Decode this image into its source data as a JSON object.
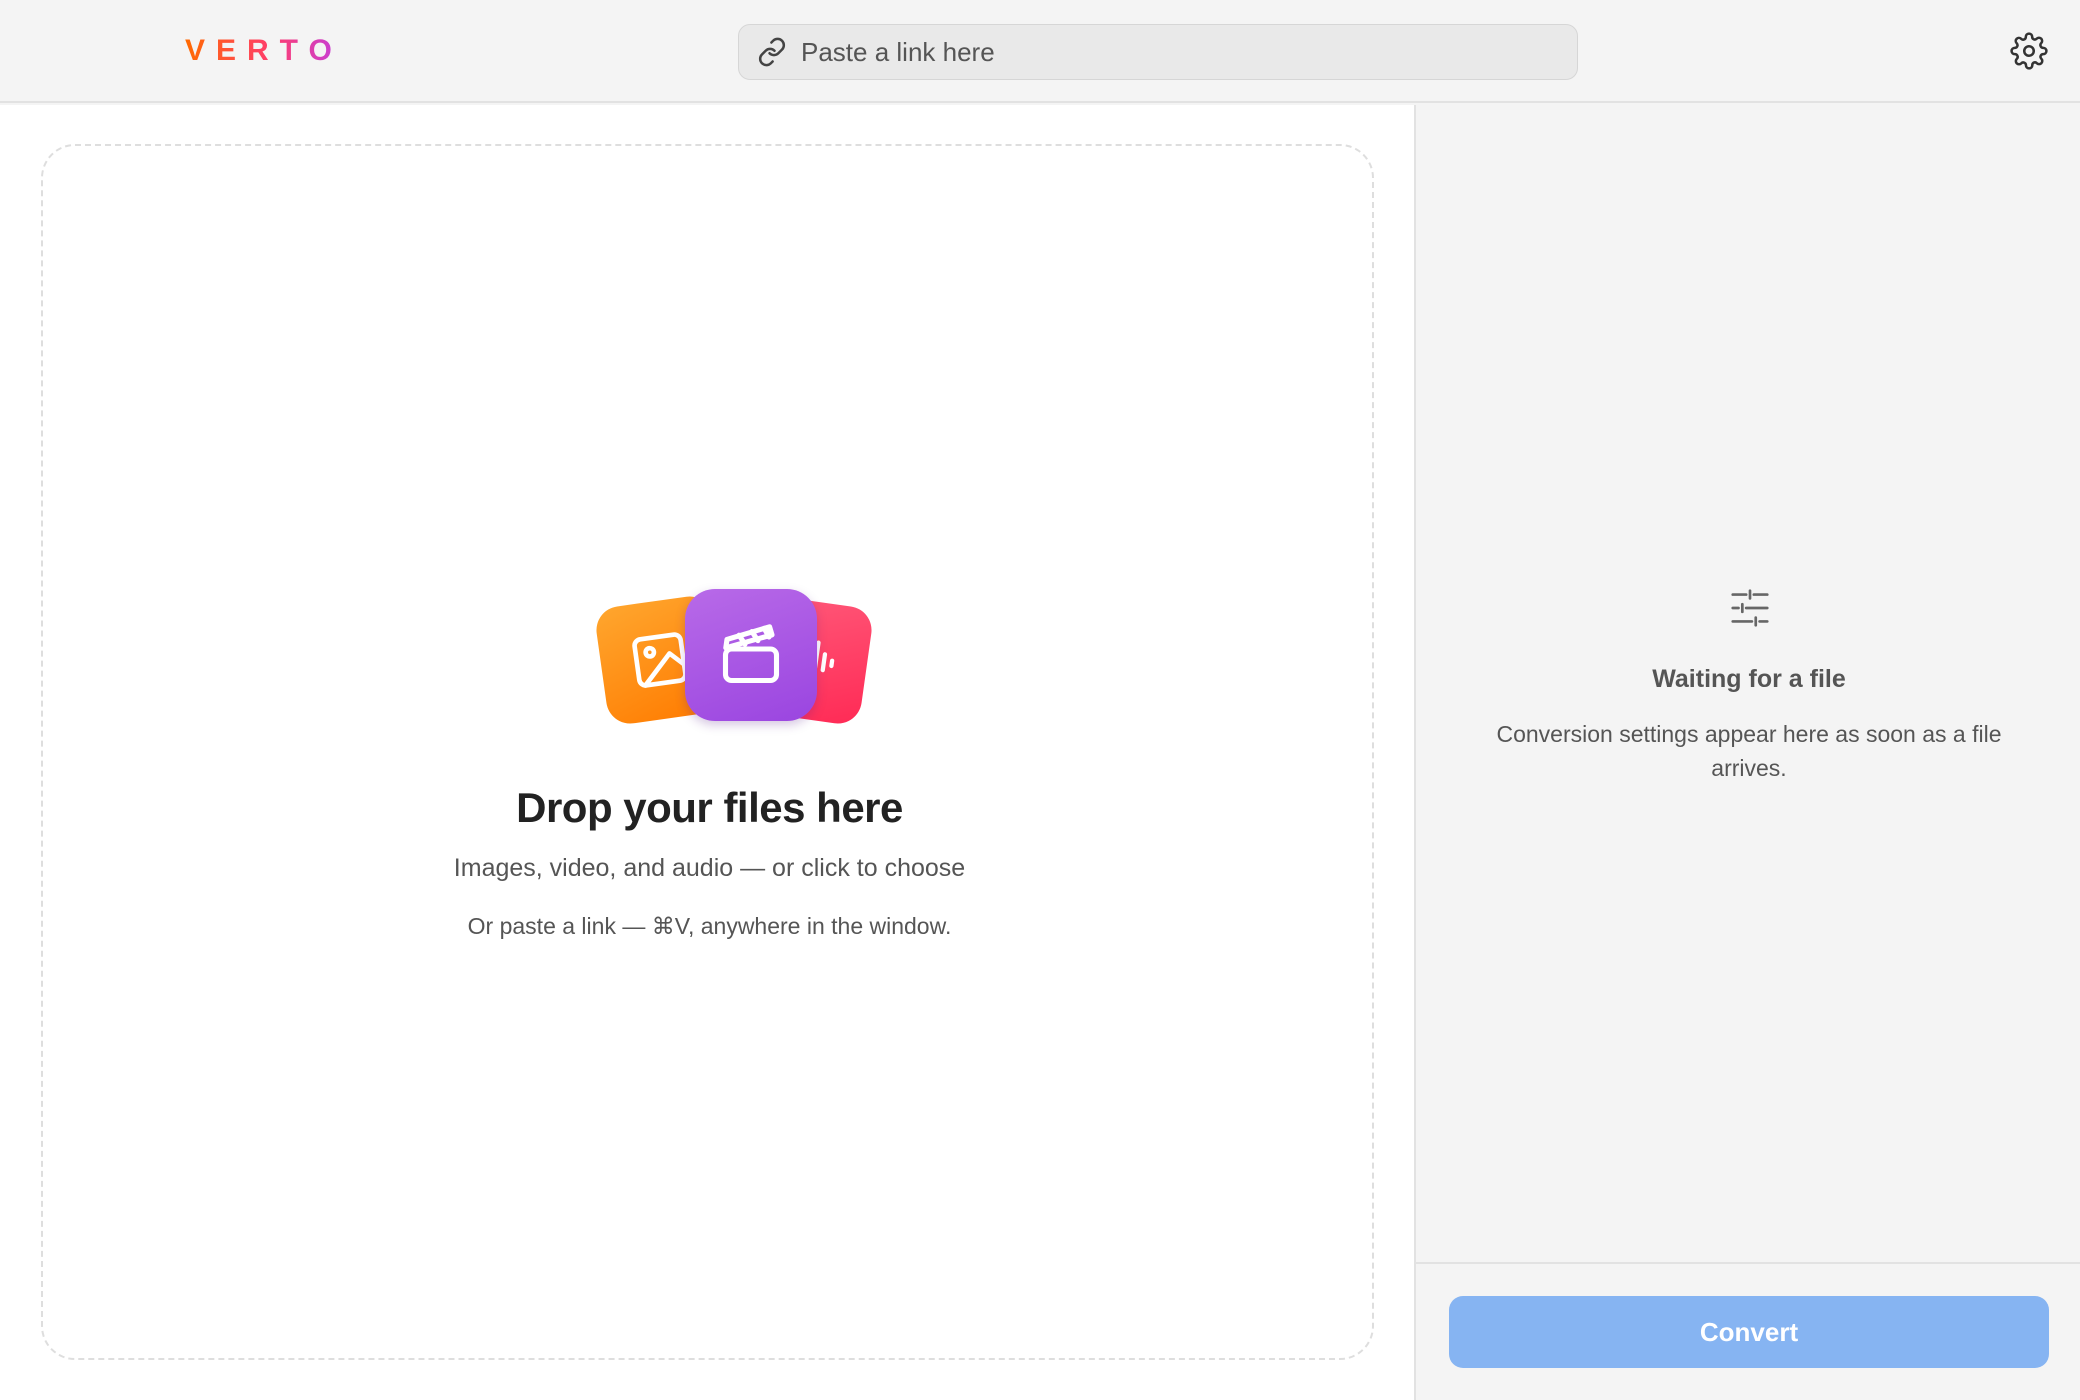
{
  "app": {
    "logo_text": "VERTO"
  },
  "toolbar": {
    "link_placeholder": "Paste a link here"
  },
  "dropzone": {
    "title": "Drop your files here",
    "subtitle": "Images, video, and audio — or click to choose",
    "hint": "Or paste a link — ⌘V, anywhere in the window.",
    "icons": [
      "image-icon",
      "video-clapper-icon",
      "audio-waveform-icon"
    ]
  },
  "sidebar": {
    "status_title": "Waiting for a file",
    "status_description": "Conversion settings appear here as soon as a file arrives.",
    "convert_label": "Convert"
  },
  "colors": {
    "accent_button_disabled": "#86b4f2",
    "image_card": "#ff8c1a",
    "video_card": "#a552e4",
    "audio_card": "#ff3a62"
  }
}
